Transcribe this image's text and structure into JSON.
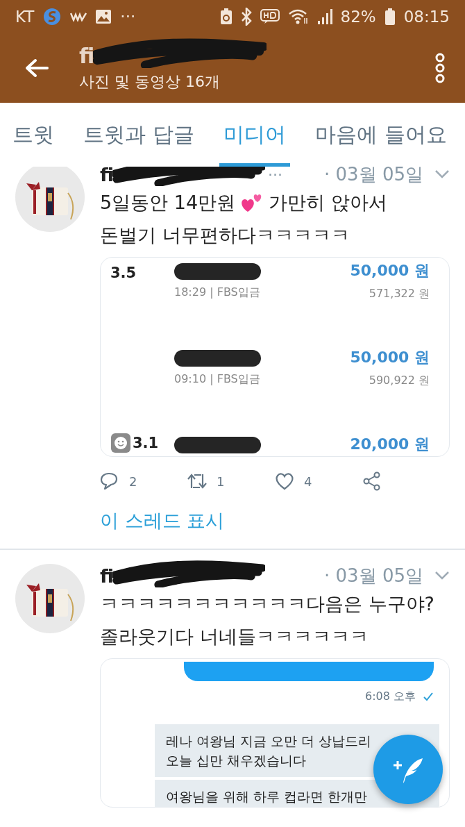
{
  "status_bar": {
    "carrier": "KT",
    "more": "···",
    "battery": "82%",
    "time": "08:15"
  },
  "header": {
    "title": "fi",
    "subtitle": "사진 및 동영상 16개"
  },
  "tabs": [
    {
      "label": "트윗",
      "selected": false
    },
    {
      "label": "트윗과 답글",
      "selected": false
    },
    {
      "label": "미디어",
      "selected": true
    },
    {
      "label": "마음에 들어요",
      "selected": false
    }
  ],
  "tweets": [
    {
      "name": "fi",
      "more": "···",
      "date": "· 03월 05일",
      "lines": [
        [
          {
            "kind": "text",
            "text": "5일동안 14만원"
          },
          {
            "kind": "emoji"
          },
          {
            "kind": "text",
            "text": "가만히 앉아서"
          }
        ],
        [
          {
            "kind": "text",
            "text": "돈벌기 너무편하다ㅋㅋㅋㅋㅋ"
          }
        ]
      ],
      "media": {
        "kind": "transactions",
        "rows": [
          {
            "date": "3.5",
            "amount": "50,000 원",
            "detail": "18:29 | FBS입금",
            "balance": "571,322 원"
          },
          {
            "amount": "50,000 원",
            "detail": "09:10 | FBS입금",
            "balance": "590,922 원"
          },
          {
            "date": "3.1",
            "amount": "20,000 원"
          }
        ]
      },
      "actions": [
        {
          "kind": "reply",
          "count": "2"
        },
        {
          "kind": "retweet",
          "count": "1"
        },
        {
          "kind": "like",
          "count": "4"
        },
        {
          "kind": "share"
        }
      ],
      "thread_link": "이 스레드 표시"
    },
    {
      "name": "fi",
      "date": "· 03월 05일",
      "lines": [
        [
          {
            "kind": "text",
            "text": "ㅋㅋㅋㅋㅋㅋㅋㅋㅋㅋㅋ다음은 누구야?"
          }
        ],
        [
          {
            "kind": "text",
            "text": "졸라웃기다 너네들ㅋㅋㅋㅋㅋㅋ"
          }
        ]
      ],
      "media": {
        "kind": "chat",
        "messages": [
          {
            "kind": "sent",
            "time": "6:08 오후"
          },
          {
            "kind": "received",
            "lines": [
              "레나 여왕님 지금 오만 더 상납드리",
              "오늘 십만 채우겠습니다"
            ]
          },
          {
            "kind": "received",
            "lines": [
              "여왕님을 위해 하루 컵라면 한개만"
            ]
          }
        ]
      }
    }
  ]
}
